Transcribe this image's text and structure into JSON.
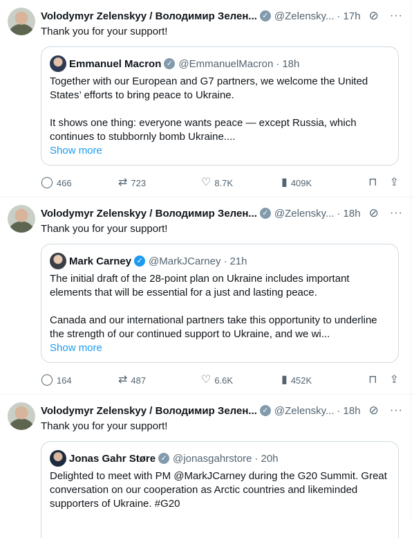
{
  "author": {
    "name": "Volodymyr Zelenskyy / Володимир Зелен...",
    "handle": "@Zelensky..."
  },
  "icons": {
    "verified": "verified-badge-icon",
    "grok": "grok-slash-icon",
    "more": "more-dots-icon",
    "reply": "reply-icon",
    "repost": "repost-icon",
    "like": "heart-icon",
    "views": "views-chart-icon",
    "bookmark": "bookmark-icon",
    "share": "share-icon"
  },
  "colors": {
    "link": "#1d9bf0",
    "muted": "#536471",
    "text": "#0f1419"
  },
  "tweets": [
    {
      "time": "17h",
      "text": "Thank you for your support!",
      "quote": {
        "name": "Emmanuel Macron",
        "handle": "@EmmanuelMacron",
        "time": "18h",
        "para1": "Together with our European and G7 partners, we welcome the United States’ efforts to bring peace to Ukraine.",
        "para2": "It shows one thing: everyone wants peace — except Russia, which continues to stubbornly bomb Ukraine....",
        "show_more": "Show more"
      },
      "stats": {
        "replies": "466",
        "reposts": "723",
        "likes": "8.7K",
        "views": "409K"
      }
    },
    {
      "time": "18h",
      "text": "Thank you for your support!",
      "quote": {
        "name": "Mark Carney",
        "handle": "@MarkJCarney",
        "time": "21h",
        "para1": "The initial draft of the 28-point plan on Ukraine includes important elements that will be essential for a just and lasting peace.",
        "para2": "Canada and our international partners take this opportunity to underline the strength of our continued support to Ukraine, and we wi...",
        "show_more": "Show more"
      },
      "stats": {
        "replies": "164",
        "reposts": "487",
        "likes": "6.6K",
        "views": "452K"
      }
    },
    {
      "time": "18h",
      "text": "Thank you for your support!",
      "quote": {
        "name": "Jonas Gahr Støre",
        "handle": "@jonasgahrstore",
        "time": "20h",
        "para1": "Delighted to meet with PM @MarkJCarney during the G20 Summit. Great conversation on our cooperation as Arctic countries and likeminded supporters of Ukraine. #G20"
      }
    }
  ]
}
